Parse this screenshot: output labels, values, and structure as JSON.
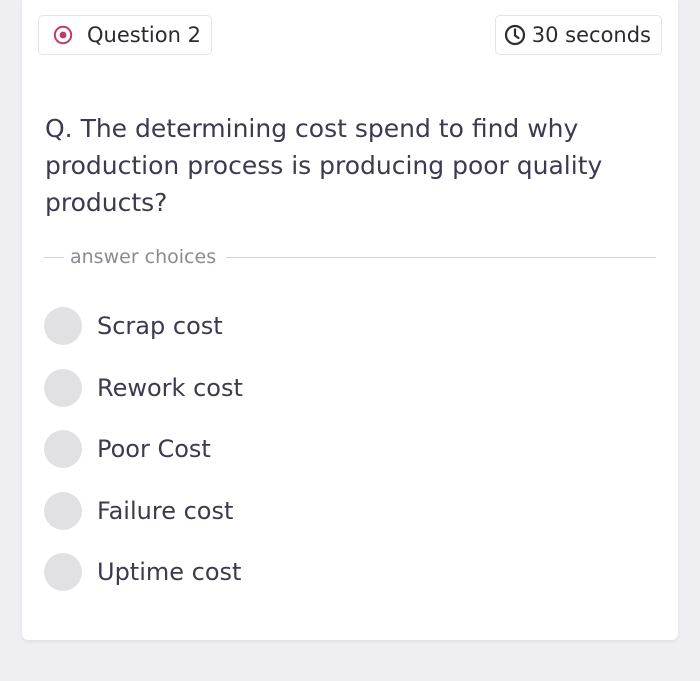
{
  "header": {
    "question_label": "Question 2",
    "timer_label": "30 seconds",
    "question_icon": "target-icon",
    "timer_icon": "clock-icon",
    "accent_color": "#c0396b"
  },
  "question": {
    "text": "Q. The determining cost spend to find why production process is producing poor quality products?"
  },
  "answer_section": {
    "label": "answer choices"
  },
  "choices": [
    {
      "label": "Scrap cost"
    },
    {
      "label": "Rework cost"
    },
    {
      "label": "Poor Cost"
    },
    {
      "label": "Failure cost"
    },
    {
      "label": "Uptime cost"
    }
  ]
}
